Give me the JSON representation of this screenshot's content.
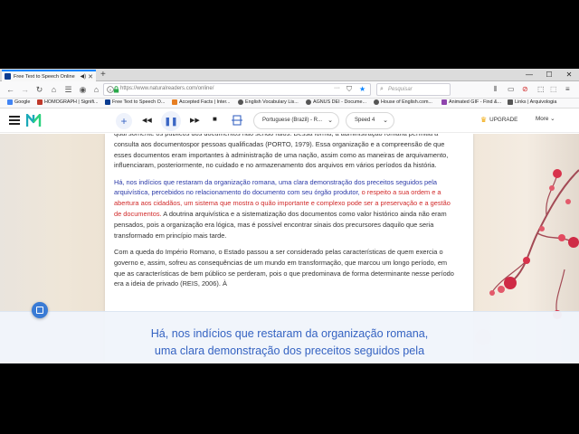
{
  "browser": {
    "tab_title": "Free Text to Speech Online",
    "new_tab_label": "+",
    "window_controls": [
      "—",
      "☐",
      "✕"
    ],
    "url": "https://www.naturalreaders.com/online/",
    "url_dots": "···",
    "search_placeholder": "Pesquisar",
    "bookmarks": [
      {
        "label": "Google",
        "color": "#4285f4"
      },
      {
        "label": "HOMOGRAPH | Signifi...",
        "color": "#c0392b"
      },
      {
        "label": "Free Text to Speech O...",
        "color": "#0b3d91"
      },
      {
        "label": "Accepted Facts | Inter...",
        "color": "#e67e22"
      },
      {
        "label": "English Vocabulary Lis...",
        "color": "#555555"
      },
      {
        "label": "AGNUS DEI - Docume...",
        "color": "#555555"
      },
      {
        "label": "House of English.com...",
        "color": "#555555"
      },
      {
        "label": "Animated GIF - Find &...",
        "color": "#8e44ad"
      },
      {
        "label": "Links | Arquivologia",
        "color": "#555555"
      }
    ]
  },
  "toolbar": {
    "add_label": "+",
    "rewind_icon": "◀◀",
    "pause_icon": "❚❚",
    "forward_icon": "▶▶",
    "stop_icon": "■",
    "voice_label": "Portuguese (Brazil) - R...",
    "speed_label": "Speed 4",
    "upgrade_label": "UPGRADE",
    "more_label": "More"
  },
  "document": {
    "p1": "qual somente os públicos dos documentos não sendo raios. Dessa forma, a administração romana permitia a consulta aos documentospor pessoas qualificadas (PORTO, 1979). Essa organização e a compreensão de que esses documentos eram importantes à administração de uma nação, assim como as maneiras de arquivamento, influenciaram, posteriormente, no cuidado e no armazenamento dos arquivos em vários períodos da história.",
    "p2_blue": "Há, nos indícios que restaram da organização romana, uma clara demonstração dos preceitos seguidos pela arquivística, percebidos no relacionamento do documento com seu órgão produtor,",
    "p2_red": " o respeito a sua ordem e a abertura aos cidadãos, um sistema que mostra o quão importante e complexo pode ser a preservação e a gestão de documentos.",
    "p2_rest": " A doutrina arquivística e a sistematização dos documentos como valor histórico ainda não eram pensados, pois a organização era lógica, mas é possível encontrar sinais dos precursores daquilo que seria transformado em princípio mais tarde.",
    "p3": "Com a queda do Império Romano, o Estado passou a ser considerado pelas características de quem exercia o governo e, assim, sofreu as consequências de um mundo em transformação, que marcou um longo período, em que as características de bem público se perderam, pois o que predominava de forma determinante nesse período era a ideia de privado (REIS, 2006). À"
  },
  "subtitle": {
    "line1": "Há, nos indícios que restaram da organização romana,",
    "line2": "uma clara demonstração dos preceitos seguidos pela"
  },
  "colors": {
    "accent_blue": "#3563c2",
    "highlight_blue": "#2b3aa8",
    "highlight_red": "#d12a2a",
    "brand_teal": "#1aa9b8"
  }
}
